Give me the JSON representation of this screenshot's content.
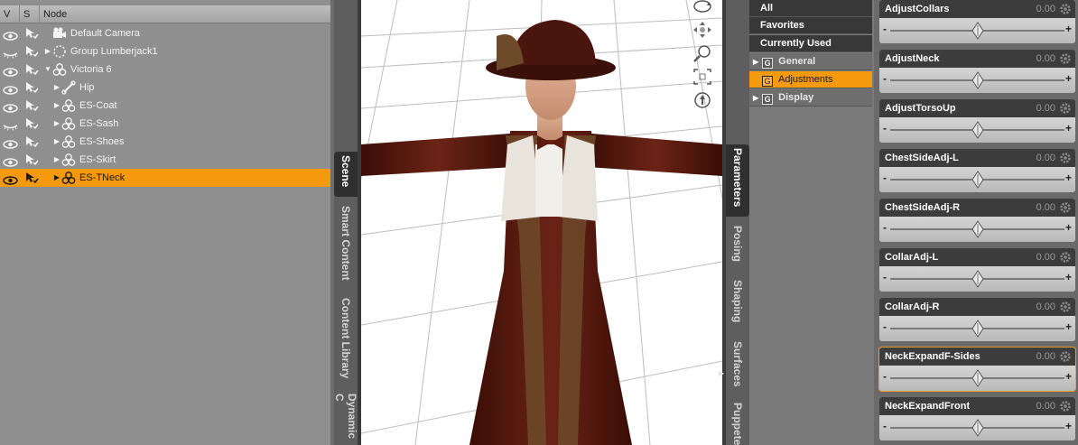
{
  "scene": {
    "headers": {
      "v": "V",
      "s": "S",
      "node": "Node"
    },
    "nodes": [
      {
        "label": "Default Camera",
        "icon": "camera-icon",
        "depth": 0,
        "expander": "",
        "eye": "open",
        "selected": false
      },
      {
        "label": "Group Lumberjack1",
        "icon": "group-icon",
        "depth": 0,
        "expander": "right",
        "eye": "closed",
        "selected": false
      },
      {
        "label": "Victoria 6",
        "icon": "figure-icon",
        "depth": 0,
        "expander": "down",
        "eye": "open",
        "selected": false
      },
      {
        "label": "Hip",
        "icon": "bone-icon",
        "depth": 1,
        "expander": "right",
        "eye": "open",
        "selected": false
      },
      {
        "label": "ES-Coat",
        "icon": "figure-icon",
        "depth": 1,
        "expander": "right",
        "eye": "open",
        "selected": false
      },
      {
        "label": "ES-Sash",
        "icon": "figure-icon",
        "depth": 1,
        "expander": "right",
        "eye": "closed",
        "selected": false
      },
      {
        "label": "ES-Shoes",
        "icon": "figure-icon",
        "depth": 1,
        "expander": "right",
        "eye": "open",
        "selected": false
      },
      {
        "label": "ES-Skirt",
        "icon": "figure-icon",
        "depth": 1,
        "expander": "right",
        "eye": "open",
        "selected": false
      },
      {
        "label": "ES-TNeck",
        "icon": "figure-icon",
        "depth": 1,
        "expander": "right",
        "eye": "open",
        "selected": true
      }
    ]
  },
  "left_tabs": {
    "scene": "Scene",
    "smart_content": "Smart Content",
    "content_library": "Content Library",
    "dynamic": "Dynamic C"
  },
  "right_tabs": {
    "parameters": "Parameters",
    "posing": "Posing",
    "shaping": "Shaping",
    "surfaces": "Surfaces",
    "puppeteer": "Puppeteer"
  },
  "groups": {
    "all": "All",
    "favorites": "Favorites",
    "currently_used": "Currently Used",
    "general": "General",
    "adjustments": "Adjustments",
    "display": "Display",
    "badge": "G"
  },
  "parameters": [
    {
      "name": "AdjustCollars",
      "value": "0.00",
      "fraction": 0.5
    },
    {
      "name": "AdjustNeck",
      "value": "0.00",
      "fraction": 0.5
    },
    {
      "name": "AdjustTorsoUp",
      "value": "0.00",
      "fraction": 0.5
    },
    {
      "name": "ChestSideAdj-L",
      "value": "0.00",
      "fraction": 0.5
    },
    {
      "name": "ChestSideAdj-R",
      "value": "0.00",
      "fraction": 0.5
    },
    {
      "name": "CollarAdj-L",
      "value": "0.00",
      "fraction": 0.5
    },
    {
      "name": "CollarAdj-R",
      "value": "0.00",
      "fraction": 0.5
    },
    {
      "name": "NeckExpandF-Sides",
      "value": "0.00",
      "fraction": 0.5,
      "highlight": true
    },
    {
      "name": "NeckExpandFront",
      "value": "0.00",
      "fraction": 0.5
    }
  ],
  "slider": {
    "minus": "-",
    "plus": "+"
  },
  "colors": {
    "accent": "#f59a0c",
    "coat": "#5a1a0f"
  },
  "viewport_tools": [
    "rotate-view-icon",
    "pan-view-icon",
    "zoom-view-icon",
    "frame-view-icon",
    "orbit-view-icon"
  ]
}
